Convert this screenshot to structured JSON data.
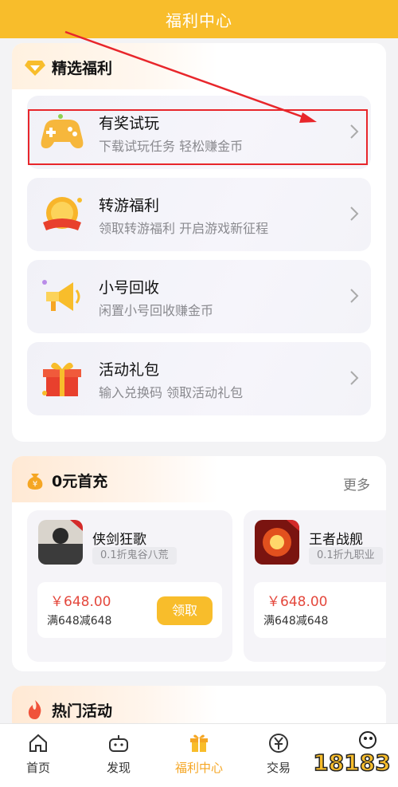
{
  "header": {
    "title": "福利中心"
  },
  "featured": {
    "title": "精选福利",
    "items": [
      {
        "title": "有奖试玩",
        "subtitle": "下载试玩任务 轻松赚金币",
        "icon": "gamepad-icon"
      },
      {
        "title": "转游福利",
        "subtitle": "领取转游福利 开启游戏新征程",
        "icon": "coin-icon"
      },
      {
        "title": "小号回收",
        "subtitle": "闲置小号回收赚金币",
        "icon": "megaphone-icon"
      },
      {
        "title": "活动礼包",
        "subtitle": "输入兑换码 领取活动礼包",
        "icon": "gift-icon"
      }
    ]
  },
  "first_charge": {
    "title": "0元首充",
    "more": "更多",
    "games": [
      {
        "name": "侠剑狂歌",
        "tag": "0.1折鬼谷八荒",
        "price": "￥648.00",
        "condition": "满648减648",
        "button": "领取"
      },
      {
        "name": "王者战舰",
        "tag": "0.1折九职业",
        "price": "￥648.00",
        "condition": "满648减648"
      }
    ]
  },
  "hot": {
    "title": "热门活动"
  },
  "tabbar": {
    "tabs": [
      {
        "label": "首页",
        "icon": "home-icon"
      },
      {
        "label": "发现",
        "icon": "discover-icon"
      },
      {
        "label": "福利中心",
        "icon": "gift-icon",
        "active": true
      },
      {
        "label": "交易",
        "icon": "yen-icon"
      }
    ]
  },
  "watermark": {
    "text": "18183"
  },
  "colors": {
    "accent": "#f8bd2b",
    "price": "#e4483d",
    "highlight": "#e8262b"
  }
}
